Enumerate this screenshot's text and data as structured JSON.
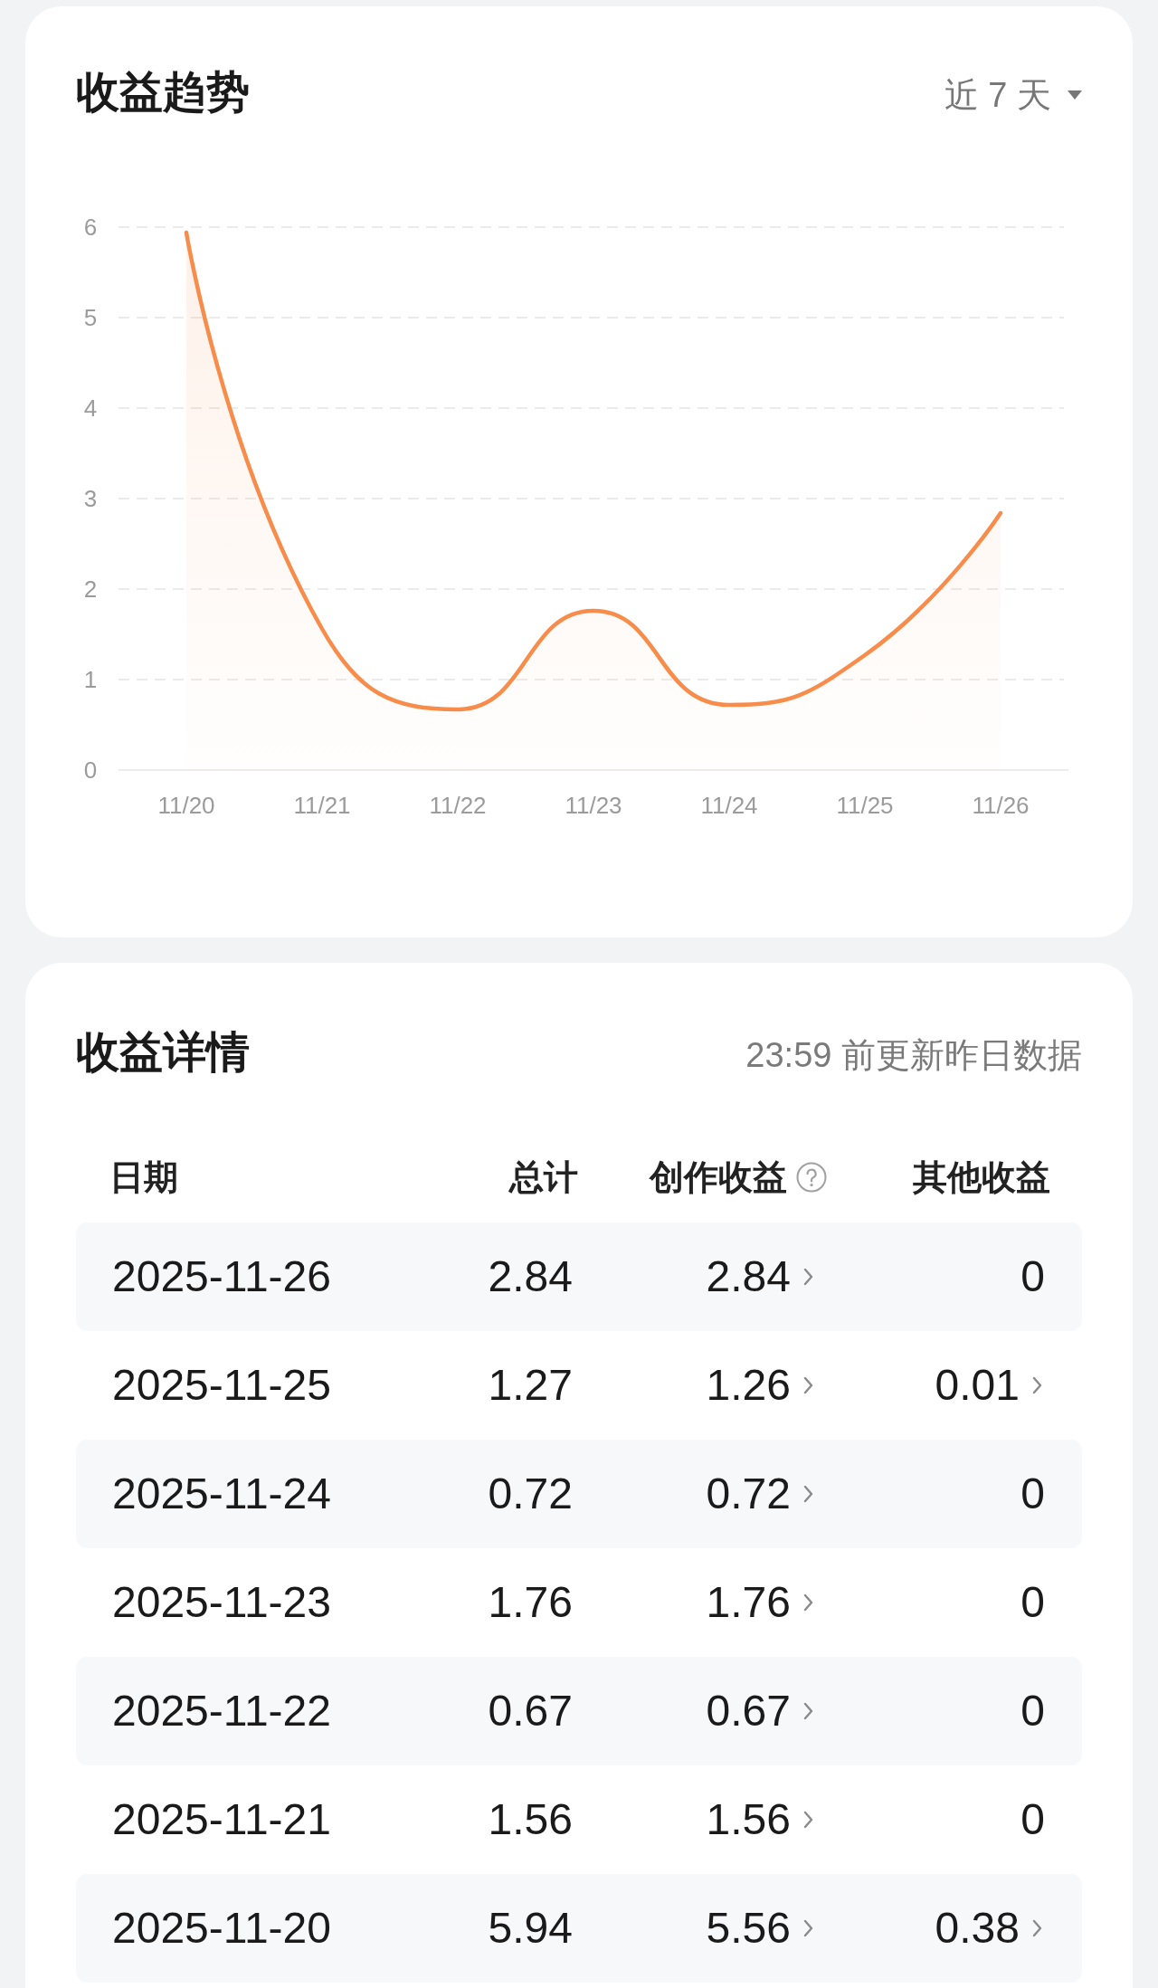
{
  "trend_card": {
    "title": "收益趋势",
    "period_dropdown": {
      "label": "近 7 天"
    },
    "chart_data": {
      "type": "area",
      "categories": [
        "11/20",
        "11/21",
        "11/22",
        "11/23",
        "11/24",
        "11/25",
        "11/26"
      ],
      "series": [
        {
          "color": "#f78c4b",
          "values": [
            5.94,
            1.56,
            0.67,
            1.76,
            0.72,
            1.27,
            2.84
          ]
        }
      ],
      "ylim": [
        0,
        6
      ],
      "yticks": [
        0,
        1,
        2,
        3,
        4,
        5,
        6
      ],
      "grid": true
    }
  },
  "details_card": {
    "title": "收益详情",
    "update_note": "23:59 前更新昨日数据",
    "columns": [
      {
        "label": "日期",
        "has_help": false
      },
      {
        "label": "总计",
        "has_help": false
      },
      {
        "label": "创作收益",
        "has_help": true
      },
      {
        "label": "其他收益",
        "has_help": false
      }
    ],
    "rows": [
      {
        "date": "2025-11-26",
        "total": "2.84",
        "creation": "2.84",
        "creation_detail": true,
        "other": "0",
        "other_detail": false
      },
      {
        "date": "2025-11-25",
        "total": "1.27",
        "creation": "1.26",
        "creation_detail": true,
        "other": "0.01",
        "other_detail": true
      },
      {
        "date": "2025-11-24",
        "total": "0.72",
        "creation": "0.72",
        "creation_detail": true,
        "other": "0",
        "other_detail": false
      },
      {
        "date": "2025-11-23",
        "total": "1.76",
        "creation": "1.76",
        "creation_detail": true,
        "other": "0",
        "other_detail": false
      },
      {
        "date": "2025-11-22",
        "total": "0.67",
        "creation": "0.67",
        "creation_detail": true,
        "other": "0",
        "other_detail": false
      },
      {
        "date": "2025-11-21",
        "total": "1.56",
        "creation": "1.56",
        "creation_detail": true,
        "other": "0",
        "other_detail": false
      },
      {
        "date": "2025-11-20",
        "total": "5.94",
        "creation": "5.56",
        "creation_detail": true,
        "other": "0.38",
        "other_detail": true
      }
    ]
  }
}
